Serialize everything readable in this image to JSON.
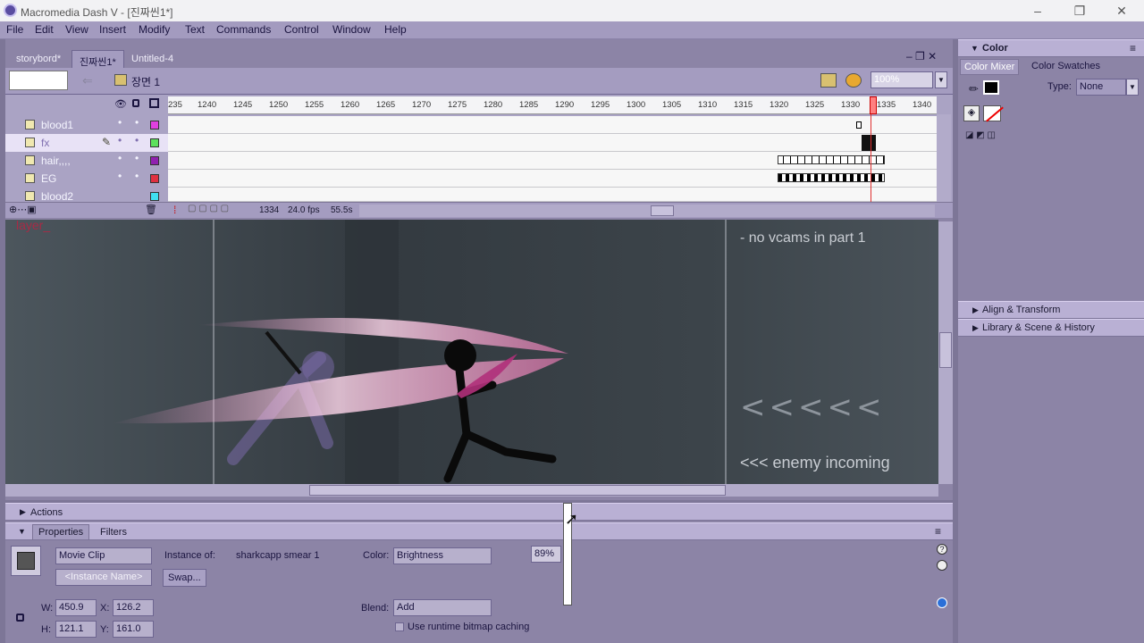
{
  "window": {
    "title": "Macromedia Dash V - [진짜씬1*]",
    "min": "–",
    "restore": "❐",
    "close": "✕"
  },
  "menu": [
    "File",
    "Edit",
    "View",
    "Insert",
    "Modify",
    "Text",
    "Commands",
    "Control",
    "Window",
    "Help"
  ],
  "tabs": [
    "storybord*",
    "진짜씬1*",
    "Untitled-4"
  ],
  "scene": {
    "name": "장면 1",
    "zoom": "100%"
  },
  "timeline": {
    "ticks": [
      "235",
      "1240",
      "1245",
      "1250",
      "1255",
      "1260",
      "1265",
      "1270",
      "1275",
      "1280",
      "1285",
      "1290",
      "1295",
      "1300",
      "1305",
      "1310",
      "1315",
      "1320",
      "1325",
      "1330",
      "1335",
      "1340"
    ],
    "layers": [
      {
        "name": "blood1",
        "color": "#e040e0"
      },
      {
        "name": "fx",
        "color": "#5ce05c"
      },
      {
        "name": "hair,,,,",
        "color": "#9020b0"
      },
      {
        "name": "EG",
        "color": "#e03040"
      },
      {
        "name": "blood2",
        "color": "#40e0f0"
      }
    ],
    "frame": "1334",
    "fps": "24.0 fps",
    "time": "55.5s"
  },
  "stage": {
    "note1": "- no vcams in part 1",
    "arrows": "<<<<<",
    "note2": "<<< enemy incoming",
    "faded": "layer_"
  },
  "panels": {
    "actions": "Actions",
    "properties": "Properties",
    "filters": "Filters"
  },
  "properties": {
    "type": "Movie Clip",
    "instance_name_placeholder": "<Instance Name>",
    "instance_of_label": "Instance of:",
    "instance_of": "sharkcapp smear 1",
    "swap": "Swap...",
    "color_label": "Color:",
    "color_value": "Brightness",
    "brightness": "89%",
    "blend_label": "Blend:",
    "blend_value": "Add",
    "bitmap_caching": "Use runtime bitmap caching",
    "w_label": "W:",
    "w": "450.9",
    "h_label": "H:",
    "h": "121.1",
    "x_label": "X:",
    "x": "126.2",
    "y_label": "Y:",
    "y": "161.0"
  },
  "right": {
    "color": "Color",
    "mixer_tab": "Color Mixer",
    "swatches_tab": "Color Swatches",
    "type_label": "Type:",
    "type_value": "None",
    "align": "Align & Transform",
    "library": "Library & Scene & History"
  }
}
